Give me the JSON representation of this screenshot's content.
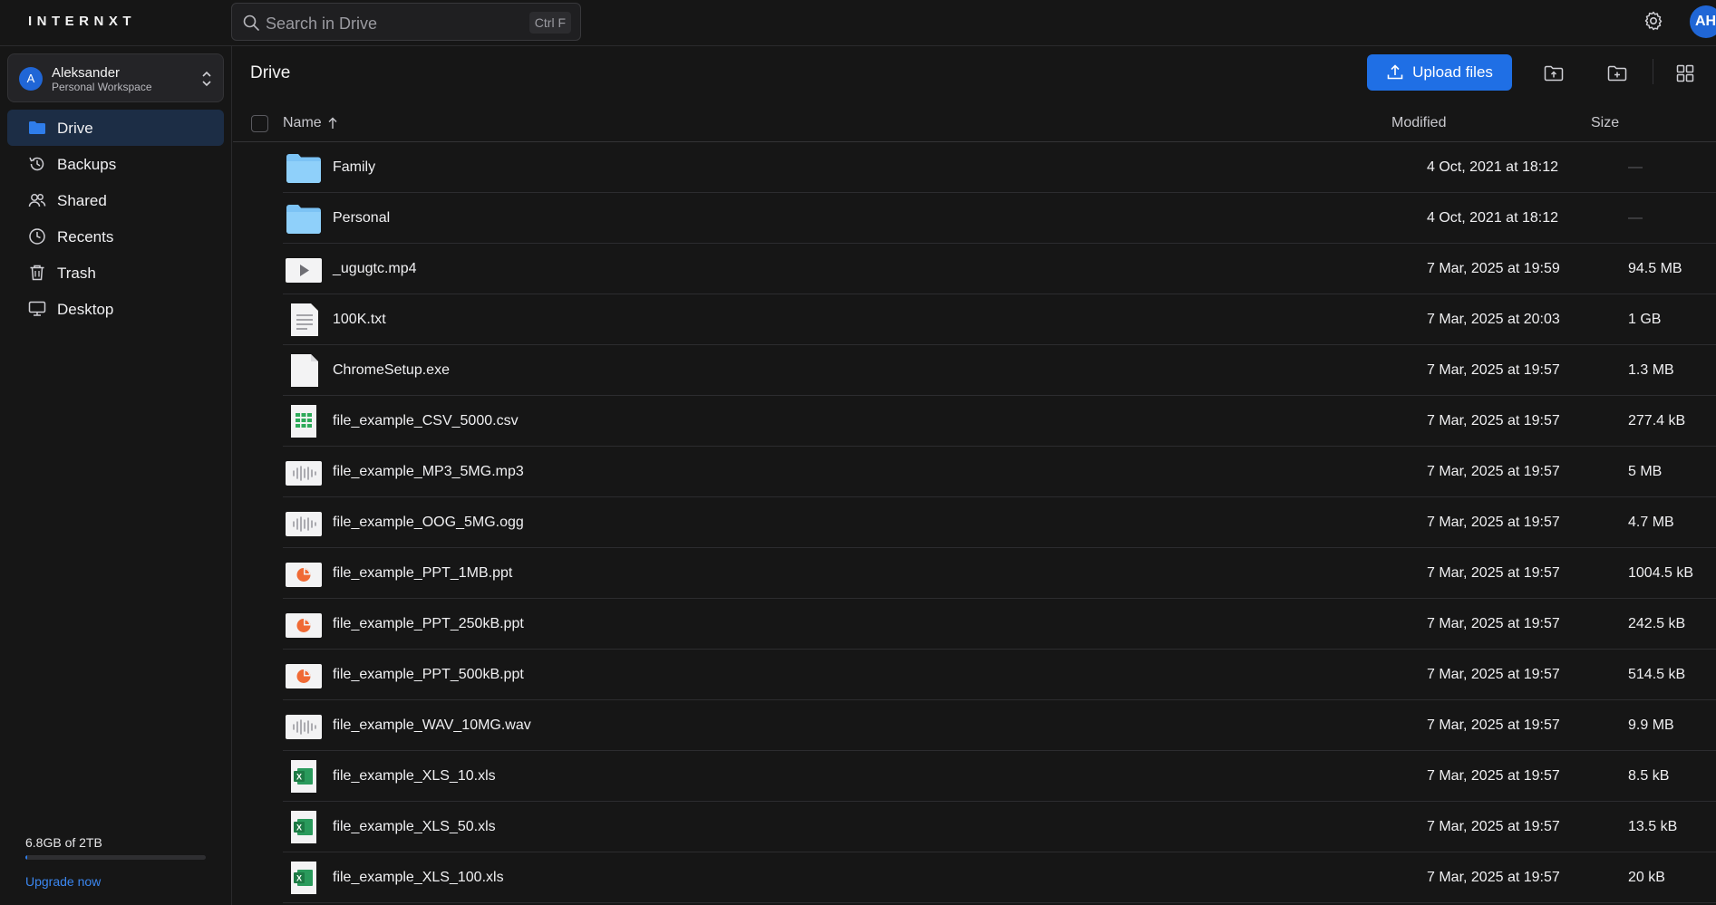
{
  "app": {
    "logo": "INTERNXT"
  },
  "header": {
    "search_placeholder": "Search in Drive",
    "search_shortcut": "Ctrl F",
    "avatar_initials": "AH"
  },
  "workspace": {
    "initial": "A",
    "name": "Aleksander",
    "subtitle": "Personal Workspace"
  },
  "sidebar": {
    "items": [
      {
        "label": "Drive",
        "icon": "folder-icon",
        "active": true
      },
      {
        "label": "Backups",
        "icon": "history-icon",
        "active": false
      },
      {
        "label": "Shared",
        "icon": "users-icon",
        "active": false
      },
      {
        "label": "Recents",
        "icon": "clock-icon",
        "active": false
      },
      {
        "label": "Trash",
        "icon": "trash-icon",
        "active": false
      },
      {
        "label": "Desktop",
        "icon": "monitor-icon",
        "active": false
      }
    ],
    "storage_text": "6.8GB of 2TB",
    "storage_used_fraction": 0.0034,
    "upgrade_label": "Upgrade now"
  },
  "main": {
    "title": "Drive",
    "upload_label": "Upload files",
    "columns": {
      "name": "Name",
      "modified": "Modified",
      "size": "Size"
    },
    "files": [
      {
        "name": "Family",
        "type": "folder",
        "modified": "4 Oct, 2021 at 18:12",
        "size": "—"
      },
      {
        "name": "Personal",
        "type": "folder",
        "modified": "4 Oct, 2021 at 18:12",
        "size": "—"
      },
      {
        "name": "_ugugtc.mp4",
        "type": "video",
        "modified": "7 Mar, 2025 at 19:59",
        "size": "94.5 MB"
      },
      {
        "name": "100K.txt",
        "type": "text",
        "modified": "7 Mar, 2025 at 20:03",
        "size": "1 GB"
      },
      {
        "name": "ChromeSetup.exe",
        "type": "generic",
        "modified": "7 Mar, 2025 at 19:57",
        "size": "1.3 MB"
      },
      {
        "name": "file_example_CSV_5000.csv",
        "type": "csv",
        "modified": "7 Mar, 2025 at 19:57",
        "size": "277.4 kB"
      },
      {
        "name": "file_example_MP3_5MG.mp3",
        "type": "audio",
        "modified": "7 Mar, 2025 at 19:57",
        "size": "5 MB"
      },
      {
        "name": "file_example_OOG_5MG.ogg",
        "type": "audio",
        "modified": "7 Mar, 2025 at 19:57",
        "size": "4.7 MB"
      },
      {
        "name": "file_example_PPT_1MB.ppt",
        "type": "ppt",
        "modified": "7 Mar, 2025 at 19:57",
        "size": "1004.5 kB"
      },
      {
        "name": "file_example_PPT_250kB.ppt",
        "type": "ppt",
        "modified": "7 Mar, 2025 at 19:57",
        "size": "242.5 kB"
      },
      {
        "name": "file_example_PPT_500kB.ppt",
        "type": "ppt",
        "modified": "7 Mar, 2025 at 19:57",
        "size": "514.5 kB"
      },
      {
        "name": "file_example_WAV_10MG.wav",
        "type": "audio",
        "modified": "7 Mar, 2025 at 19:57",
        "size": "9.9 MB"
      },
      {
        "name": "file_example_XLS_10.xls",
        "type": "xls",
        "modified": "7 Mar, 2025 at 19:57",
        "size": "8.5 kB"
      },
      {
        "name": "file_example_XLS_50.xls",
        "type": "xls",
        "modified": "7 Mar, 2025 at 19:57",
        "size": "13.5 kB"
      },
      {
        "name": "file_example_XLS_100.xls",
        "type": "xls",
        "modified": "7 Mar, 2025 at 19:57",
        "size": "20 kB"
      }
    ]
  },
  "colors": {
    "accent": "#1f6fe5",
    "folder": "#7cc3f5",
    "ppt": "#f06a35",
    "csv": "#2eaa5a",
    "xls": "#1d7a45"
  }
}
